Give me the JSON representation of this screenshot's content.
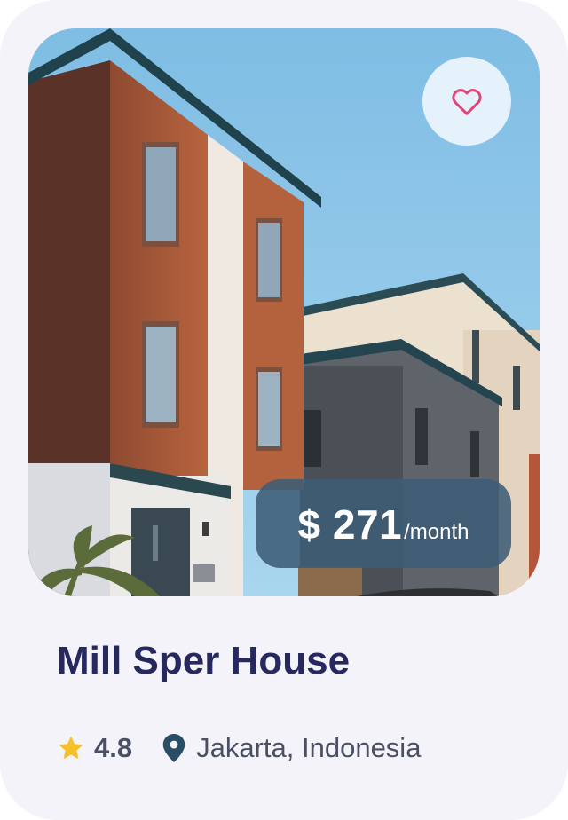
{
  "listing": {
    "price": "$ 271",
    "price_unit": "/month",
    "title": "Mill Sper House",
    "rating": "4.8",
    "location": "Jakarta, Indonesia"
  },
  "icons": {
    "favorite": "heart-icon",
    "rating": "star-icon",
    "location": "map-pin-icon"
  },
  "colors": {
    "card_background": "#f4f3f9",
    "title": "#27295e",
    "text": "#4a4f64",
    "heart": "#e0457b",
    "star": "#f6c02c",
    "pin": "#2a4d66",
    "price_badge": "#3e5c76",
    "favorite_button": "#e5f2fb"
  }
}
